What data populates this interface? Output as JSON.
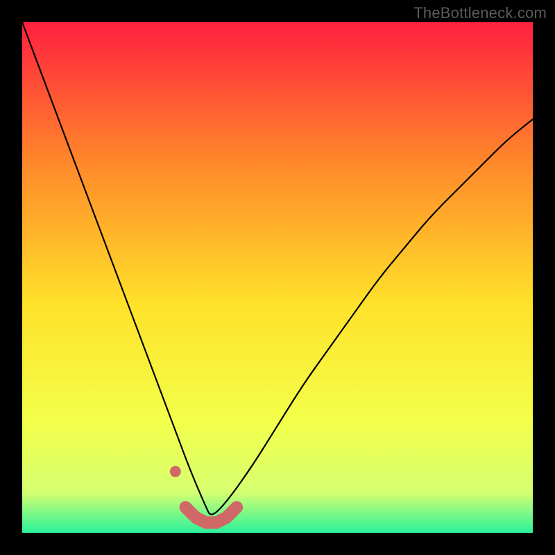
{
  "watermark": "TheBottleneck.com",
  "colors": {
    "frame": "#000000",
    "curve": "#000000",
    "marker_fill": "#d06868",
    "marker_stroke": "#c25a5a",
    "gradient_top": "#ff203f",
    "gradient_mid1": "#ff8a2a",
    "gradient_mid2": "#ffe12a",
    "gradient_mid3": "#f3ff4a",
    "gradient_bottom_band": "#d6ff70",
    "gradient_bottom": "#2bf29b"
  },
  "chart_data": {
    "type": "line",
    "title": "",
    "xlabel": "",
    "ylabel": "",
    "xlim": [
      0,
      100
    ],
    "ylim": [
      0,
      100
    ],
    "grid": false,
    "legend": false,
    "annotations": [
      "TheBottleneck.com"
    ],
    "series": [
      {
        "name": "bottleneck_curve_left",
        "x": [
          0,
          3,
          6,
          9,
          12,
          15,
          18,
          21,
          24,
          27,
          30,
          33,
          36,
          37
        ],
        "values": [
          100,
          92,
          84,
          76,
          68,
          60,
          52,
          44,
          36,
          28,
          20,
          12,
          5,
          3
        ]
      },
      {
        "name": "bottleneck_curve_right",
        "x": [
          37,
          40,
          45,
          50,
          55,
          60,
          65,
          70,
          75,
          80,
          85,
          90,
          95,
          100
        ],
        "values": [
          3,
          6,
          13,
          21,
          29,
          36,
          43,
          50,
          56,
          62,
          67,
          72,
          77,
          81
        ]
      }
    ],
    "markers": {
      "name": "highlighted_points",
      "style": "thick_rounded_salmon",
      "x": [
        30,
        32,
        34,
        36,
        38,
        40,
        42
      ],
      "values": [
        12,
        5,
        3,
        2,
        2,
        3,
        5
      ]
    }
  }
}
